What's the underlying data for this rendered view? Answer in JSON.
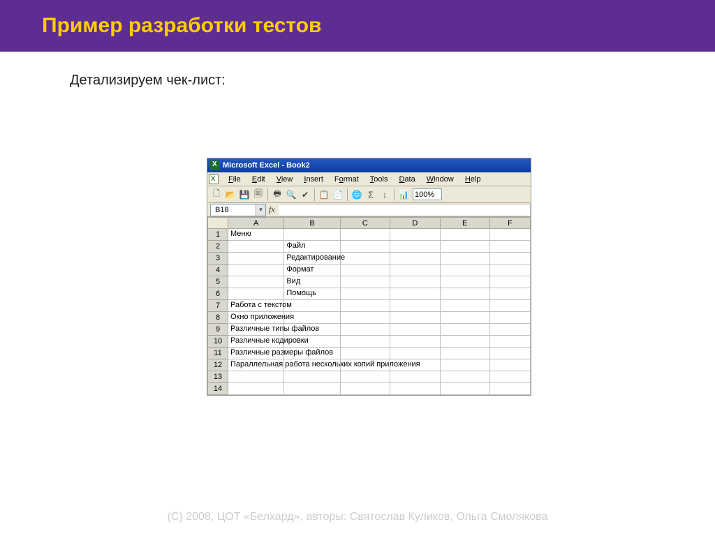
{
  "slide": {
    "title": "Пример разработки тестов",
    "subtitle": "Детализируем чек-лист:",
    "footer": "(C) 2008, ЦОТ «Белхард», авторы: Святослав Куликов, Ольга Смолякова"
  },
  "excel": {
    "window_title": "Microsoft Excel - Book2",
    "menu": [
      "File",
      "Edit",
      "View",
      "Insert",
      "Format",
      "Tools",
      "Data",
      "Window",
      "Help"
    ],
    "zoom": "100%",
    "name_box": "B18",
    "fx_label": "fx",
    "columns": [
      "A",
      "B",
      "C",
      "D",
      "E",
      "F"
    ],
    "rows": [
      {
        "n": "1",
        "A": "Меню",
        "B": ""
      },
      {
        "n": "2",
        "A": "",
        "B": "Файл"
      },
      {
        "n": "3",
        "A": "",
        "B": "Редактирование"
      },
      {
        "n": "4",
        "A": "",
        "B": "Формат"
      },
      {
        "n": "5",
        "A": "",
        "B": "Вид"
      },
      {
        "n": "6",
        "A": "",
        "B": "Помощь"
      },
      {
        "n": "7",
        "A": "Работа с текстом",
        "B": ""
      },
      {
        "n": "8",
        "A": "Окно приложения",
        "B": ""
      },
      {
        "n": "9",
        "A": "Различные типы файлов",
        "B": ""
      },
      {
        "n": "10",
        "A": "Различные кодировки",
        "B": ""
      },
      {
        "n": "11",
        "A": "Различные размеры файлов",
        "B": ""
      },
      {
        "n": "12",
        "A": "Параллельная работа нескольких копий приложения",
        "B": ""
      },
      {
        "n": "13",
        "A": "",
        "B": ""
      },
      {
        "n": "14",
        "A": "",
        "B": ""
      }
    ]
  }
}
